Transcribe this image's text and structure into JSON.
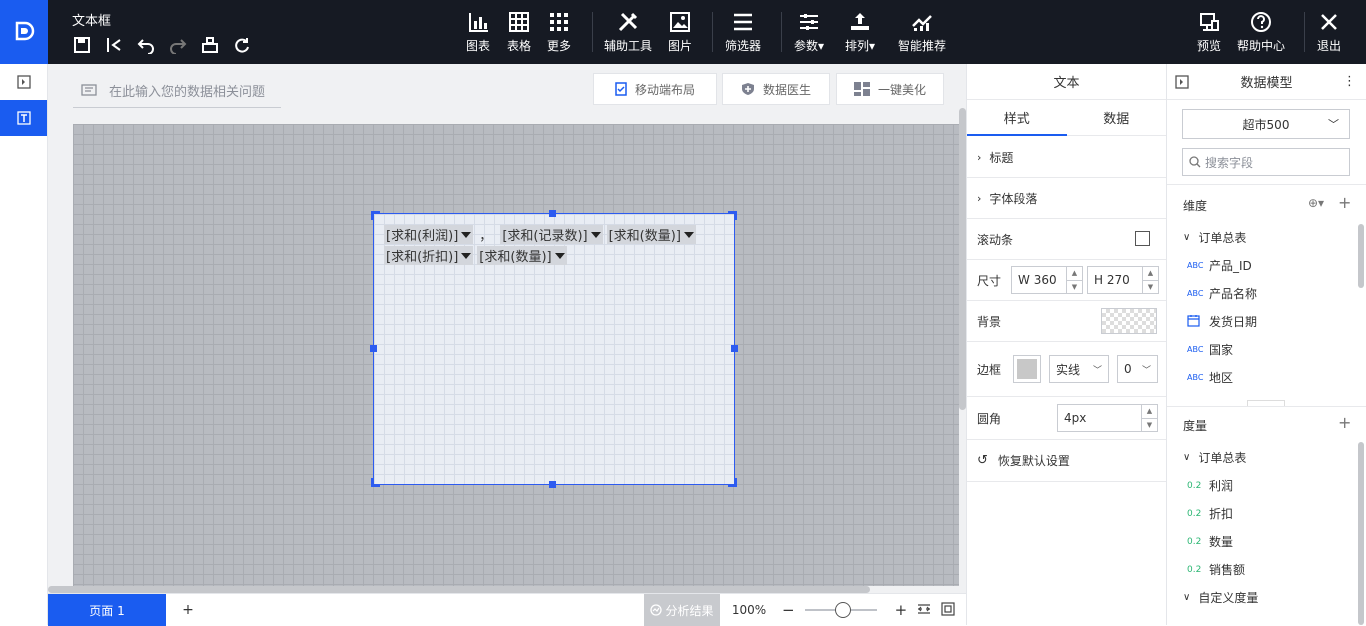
{
  "app": {
    "doc_title": "文本框"
  },
  "toolbar": {
    "chart": "图表",
    "table": "表格",
    "more": "更多",
    "assist": "辅助工具",
    "image": "图片",
    "filter": "筛选器",
    "params": "参数",
    "sort": "排列",
    "smart": "智能推荐",
    "preview": "预览",
    "help": "帮助中心",
    "exit": "退出"
  },
  "header": {
    "ask_placeholder": "在此输入您的数据相关问题",
    "mobile_layout": "移动端布局",
    "data_doctor": "数据医生",
    "beautify": "一键美化"
  },
  "textbox": {
    "line1": [
      "[求和(利润)]",
      "[求和(记录数)]",
      "[求和(数量)]"
    ],
    "line1_sep": "，",
    "line2": [
      "[求和(折扣)]",
      "[求和(数量)]"
    ]
  },
  "bottom": {
    "page_tab": "页面 1",
    "add_page": "+",
    "analysis": "分析结果",
    "zoom": "100%"
  },
  "right_panel": {
    "title": "文本",
    "tab_style": "样式",
    "tab_data": "数据",
    "section_title": "标题",
    "section_font": "字体段落",
    "scrollbar": "滚动条",
    "size_label": "尺寸",
    "width_prefix": "W",
    "width": "360",
    "height_prefix": "H",
    "height": "270",
    "background": "背景",
    "border_label": "边框",
    "border_style": "实线",
    "border_width": "0",
    "radius_label": "圆角",
    "radius": "4px",
    "reset": "恢复默认设置"
  },
  "data_model": {
    "title": "数据模型",
    "dataset": "超市500",
    "search_placeholder": "搜索字段",
    "dimension_label": "维度",
    "dim_group": "订单总表",
    "dimensions": [
      {
        "type": "ABC",
        "name": "产品_ID"
      },
      {
        "type": "date",
        "name": "产品名称"
      },
      {
        "type": "date",
        "name": "发货日期"
      },
      {
        "type": "ABC",
        "name": "国家"
      },
      {
        "type": "ABC",
        "name": "地区"
      }
    ],
    "measure_label": "度量",
    "measure_group": "订单总表",
    "measures": [
      {
        "type": "0.2",
        "name": "利润"
      },
      {
        "type": "0.2",
        "name": "折扣"
      },
      {
        "type": "0.2",
        "name": "数量"
      },
      {
        "type": "0.2",
        "name": "销售额"
      }
    ],
    "custom_measure": "自定义度量"
  },
  "colors": {
    "accent": "#1a5cf0",
    "topbar": "#161a23"
  }
}
